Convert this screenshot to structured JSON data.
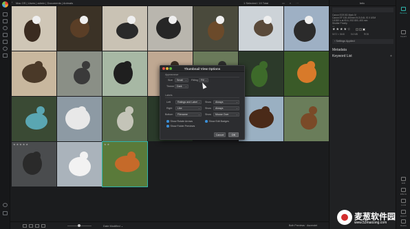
{
  "topbar": {
    "back_label": "‹",
    "breadcrumb": "Mac OS | Users | admin | Documents | Animals",
    "selection_status": "1 Selected / 19 Total",
    "tools": "▭ ⌕ ⋯"
  },
  "grid": {
    "selected_index": 23,
    "ratings": [
      "★★★★★",
      "",
      "★★"
    ],
    "palette": [
      "#d9cfc0",
      "#3a4a2e",
      "#8a7a63",
      "#7c8a68",
      "#4b5a42",
      "#2f3236",
      "#6f7e8f",
      "#9fb3c5"
    ]
  },
  "dialog": {
    "title": "Thumbnail View Options",
    "appearance_heading": "Appearance",
    "size_label": "Size",
    "size_value": "Small",
    "fitting_label": "Fitting",
    "fitting_value": "Fill",
    "theme_label": "Theme",
    "theme_value": "Dark",
    "labels_heading": "Labels",
    "left_label": "Left",
    "left_value": "Ratings and Label",
    "right_label": "Right",
    "right_value": "Like",
    "bottom_label": "Bottom",
    "bottom_value": "Filename",
    "show1_label": "Show",
    "show1_value": "Always",
    "show2_label": "Show",
    "show2_value": "Always",
    "show3_label": "Show",
    "show3_value": "Mouse Over",
    "opt_rotate": "Show Rotate Arrows",
    "opt_badges": "Show Edit Badges",
    "opt_folder": "Show Folder Previews",
    "cancel": "Cancel",
    "ok": "OK"
  },
  "rpanel": {
    "tab": "Info",
    "info_lines": [
      "Canon EOS 5D Mark IV",
      "Canon EF 100-400mm f/4.5-5.6L IS II USM",
      "1/1000 s at f/5.6, ISO 800, 400 mm",
      "Shutter Priority",
      "—"
    ],
    "stars": "★★★★☆",
    "meta_a": "5472 × 3648",
    "meta_b": "5.6 MB",
    "meta_c": "RGB",
    "settings": "› Settings Applied",
    "metadata": "Metadata",
    "keyword_list": "Keyword List",
    "plus": "+"
  },
  "rstrip": {
    "items": [
      "Browse",
      "Layers",
      "Edit",
      "Effects",
      "Local",
      "Export",
      "Resize"
    ]
  },
  "bottombar": {
    "sort": "Date Modified ⌄",
    "filter": "Both Previews  ·  Ascendet"
  },
  "watermark": {
    "cn": "麦葱软件园",
    "url": "www.52maicong.com",
    "url2": "www.52maicong.com"
  },
  "colors": {
    "accent": "#2fb5ad",
    "checkbox": "#3b8fd8",
    "close": "#e0534a",
    "min": "#e2b23c",
    "max": "#57b53c"
  }
}
